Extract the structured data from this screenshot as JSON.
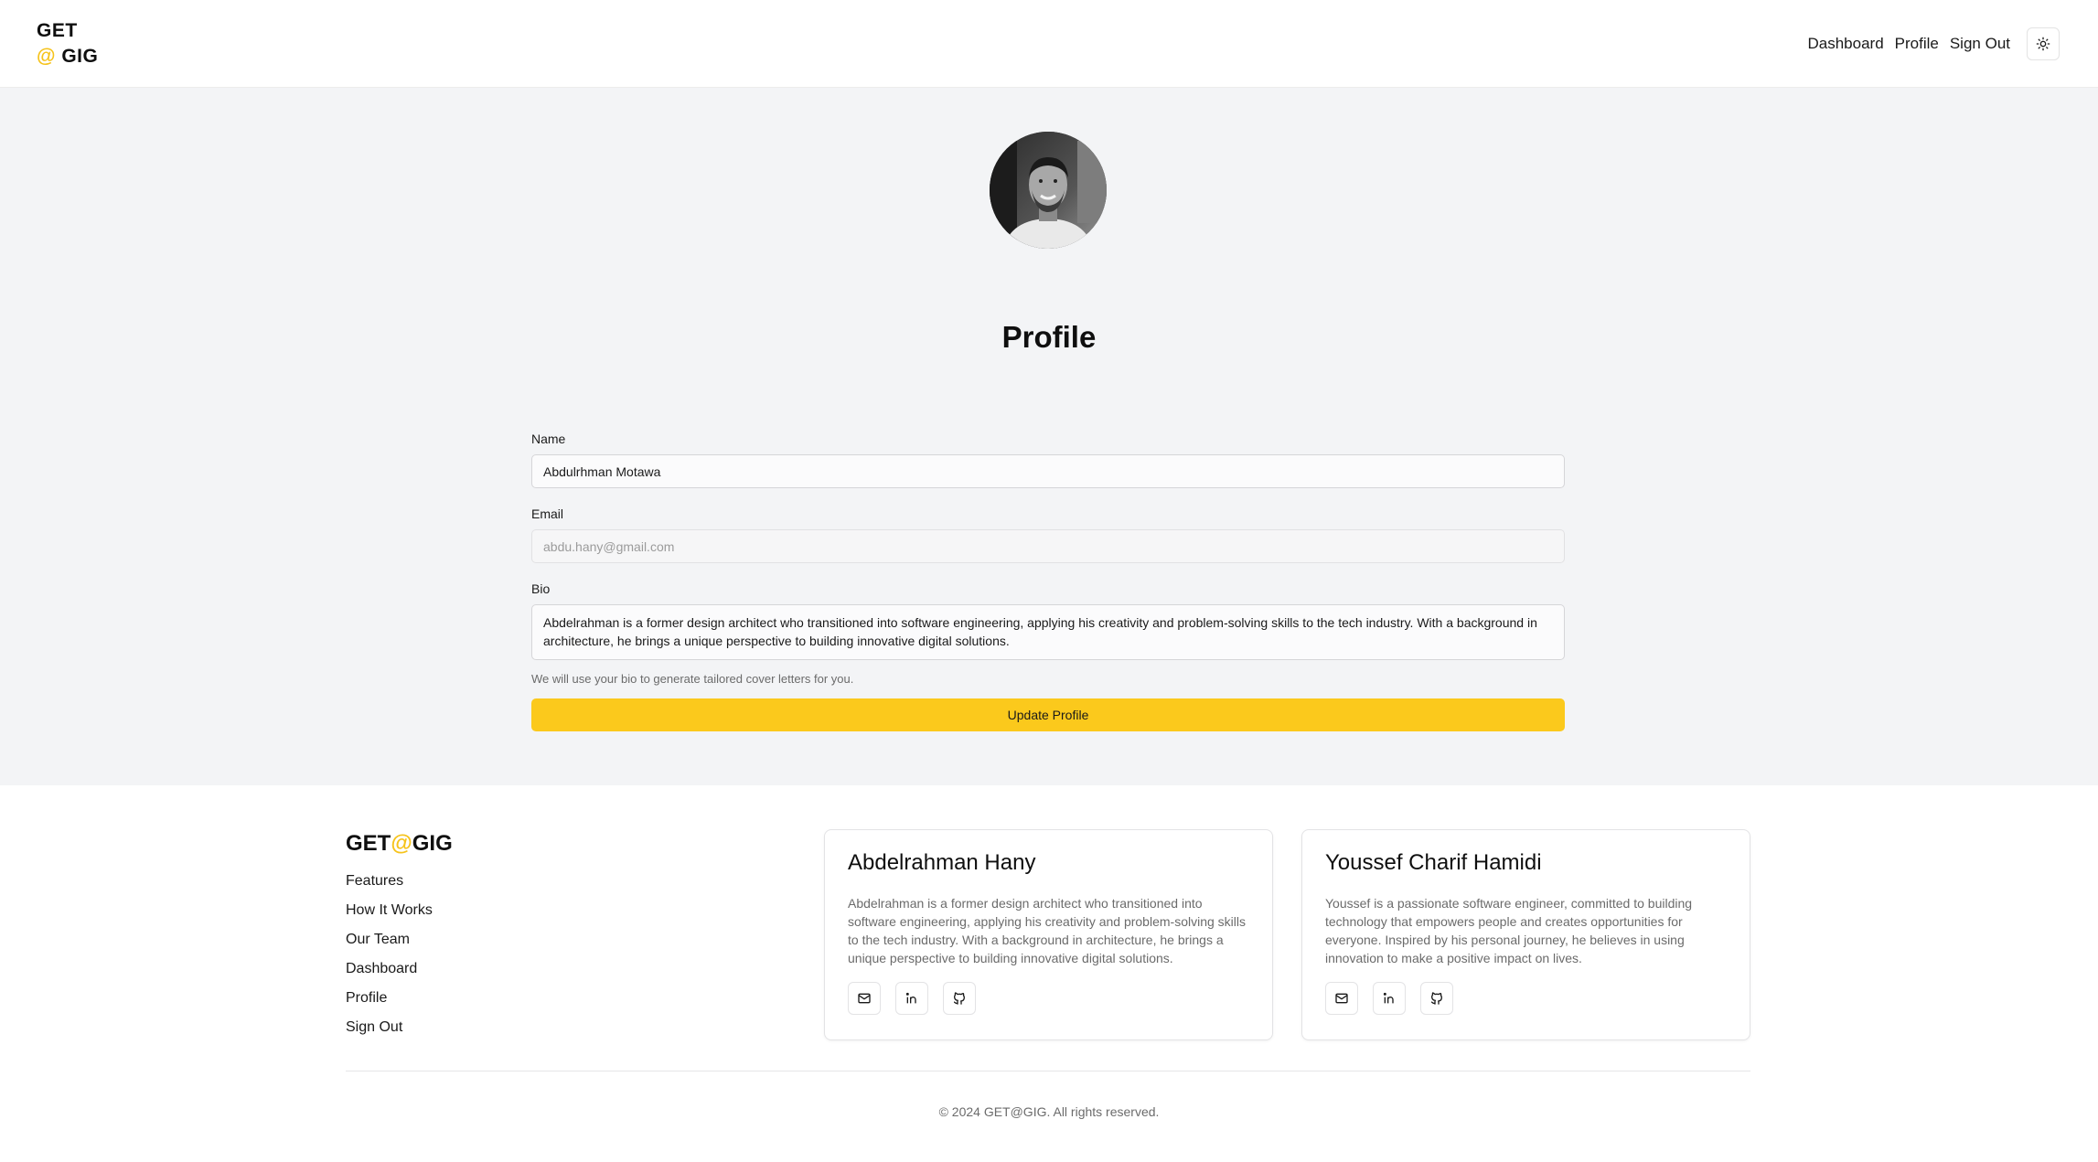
{
  "header": {
    "logo_line1": "GET",
    "logo_at": "@",
    "logo_line2": " GIG",
    "nav": [
      "Dashboard",
      "Profile",
      "Sign Out"
    ],
    "theme_icon": "sun-icon"
  },
  "main": {
    "title": "Profile",
    "form": {
      "name_label": "Name",
      "name_value": "Abdulrhman Motawa",
      "email_label": "Email",
      "email_value": "abdu.hany@gmail.com",
      "bio_label": "Bio",
      "bio_value": "Abdelrahman is a former design architect who transitioned into software engineering, applying his creativity and problem-solving skills to the tech industry. With a background in architecture, he brings a unique perspective to building innovative digital solutions.",
      "bio_hint": "We will use your bio to generate tailored cover letters for you.",
      "submit_label": "Update Profile"
    }
  },
  "footer": {
    "logo_get": "GET",
    "logo_at": "@",
    "logo_gig": "GIG",
    "links": [
      "Features",
      "How It Works",
      "Our Team",
      "Dashboard",
      "Profile",
      "Sign Out"
    ],
    "team": [
      {
        "name": "Abdelrahman Hany",
        "bio": "Abdelrahman is a former design architect who transitioned into software engineering, applying his creativity and problem-solving skills to the tech industry. With a background in architecture, he brings a unique perspective to building innovative digital solutions."
      },
      {
        "name": "Youssef Charif Hamidi",
        "bio": "Youssef is a passionate software engineer, committed to building technology that empowers people and creates opportunities for everyone. Inspired by his personal journey, he believes in using innovation to make a positive impact on lives."
      }
    ],
    "copyright": "© 2024 GET@GIG. All rights reserved."
  },
  "colors": {
    "accent": "#fbc91c",
    "background": "#f3f4f6"
  }
}
